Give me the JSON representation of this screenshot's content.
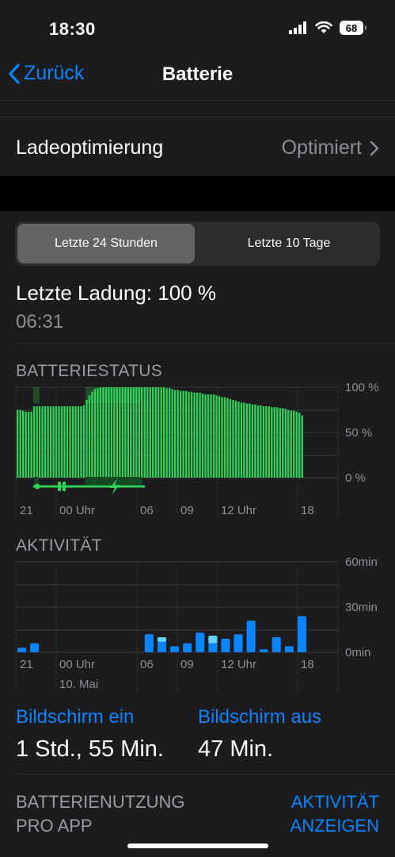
{
  "status_bar": {
    "time": "18:30",
    "battery_level": "68"
  },
  "nav": {
    "back_label": "Zurück",
    "title": "Batterie"
  },
  "charging_optimization": {
    "label": "Ladeoptimierung",
    "value": "Optimiert"
  },
  "range_selector": {
    "options": [
      "Letzte 24 Stunden",
      "Letzte 10 Tage"
    ],
    "selected": "Letzte 24 Stunden"
  },
  "last_charge": {
    "label": "Letzte Ladung: 100 %",
    "time": "06:31"
  },
  "battery_status": {
    "heading": "BATTERIESTATUS",
    "y_labels": [
      "100 %",
      "50 %",
      "0 %"
    ],
    "x_labels": [
      "21",
      "00 Uhr",
      "06",
      "09",
      "12 Uhr",
      "18"
    ]
  },
  "activity": {
    "heading": "AKTIVITÄT",
    "y_labels": [
      "60min",
      "30min",
      "0min"
    ],
    "x_labels": [
      "21",
      "00 Uhr",
      "06",
      "09",
      "12 Uhr",
      "18"
    ],
    "date_label": "10. Mai"
  },
  "screen_stats": {
    "on_label": "Bildschirm ein",
    "on_value": "1 Std., 55 Min.",
    "off_label": "Bildschirm aus",
    "off_value": "47 Min."
  },
  "usage": {
    "left_line1": "BATTERIENUTZUNG",
    "left_line2": "PRO APP",
    "right_line1": "AKTIVITÄT",
    "right_line2": "ANZEIGEN"
  },
  "colors": {
    "accent": "#0a84ff",
    "battery_green": "#30d158",
    "activity_blue": "#0a84ff",
    "activity_light_blue": "#64d2ff"
  },
  "chart_data": [
    {
      "type": "bar",
      "title": "BATTERIESTATUS",
      "ylim": [
        0,
        100
      ],
      "x_ticks": [
        "21",
        "00 Uhr",
        "06",
        "09",
        "12 Uhr",
        "18"
      ],
      "values": [
        75,
        75,
        74,
        73,
        73,
        73,
        79,
        79,
        79,
        79,
        79,
        79,
        79,
        79,
        79,
        79,
        79,
        79,
        79,
        79,
        79,
        79,
        79,
        79,
        80,
        86,
        91,
        95,
        98,
        99,
        100,
        100,
        100,
        100,
        100,
        100,
        100,
        100,
        100,
        100,
        100,
        100,
        100,
        100,
        100,
        100,
        100,
        100,
        100,
        100,
        100,
        100,
        100,
        100,
        99,
        99,
        98,
        97,
        97,
        96,
        96,
        96,
        95,
        95,
        94,
        94,
        94,
        93,
        92,
        92,
        92,
        92,
        91,
        90,
        89,
        89,
        88,
        87,
        86,
        85,
        84,
        83,
        83,
        82,
        82,
        81,
        81,
        80,
        80,
        79,
        79,
        79,
        78,
        78,
        78,
        77,
        77,
        76,
        75,
        74,
        74,
        73,
        72,
        69
      ],
      "charging_segments": [
        [
          0.18,
          0.62
        ],
        [
          0.5,
          0.75
        ]
      ]
    },
    {
      "type": "bar",
      "title": "AKTIVITÄT",
      "ylim": [
        0,
        60
      ],
      "x_ticks": [
        "21",
        "00 Uhr",
        "06",
        "09",
        "12 Uhr",
        "18"
      ],
      "series": [
        {
          "values": [
            3,
            6,
            0,
            0,
            0,
            0,
            0,
            0,
            0,
            0,
            12,
            10,
            4,
            6,
            13,
            11,
            9,
            12,
            21,
            2,
            10,
            4,
            24
          ],
          "lit": [
            0,
            0,
            0,
            0,
            0,
            0,
            0,
            0,
            0,
            0,
            0,
            0,
            0,
            0,
            0,
            0,
            0,
            0,
            0,
            0,
            0,
            0,
            0
          ]
        },
        {
          "values": [
            0,
            0,
            0,
            0,
            0,
            0,
            0,
            0,
            0,
            0,
            0,
            1,
            0,
            0,
            0,
            3,
            0,
            0,
            0,
            0,
            0,
            0,
            0
          ]
        }
      ]
    }
  ]
}
